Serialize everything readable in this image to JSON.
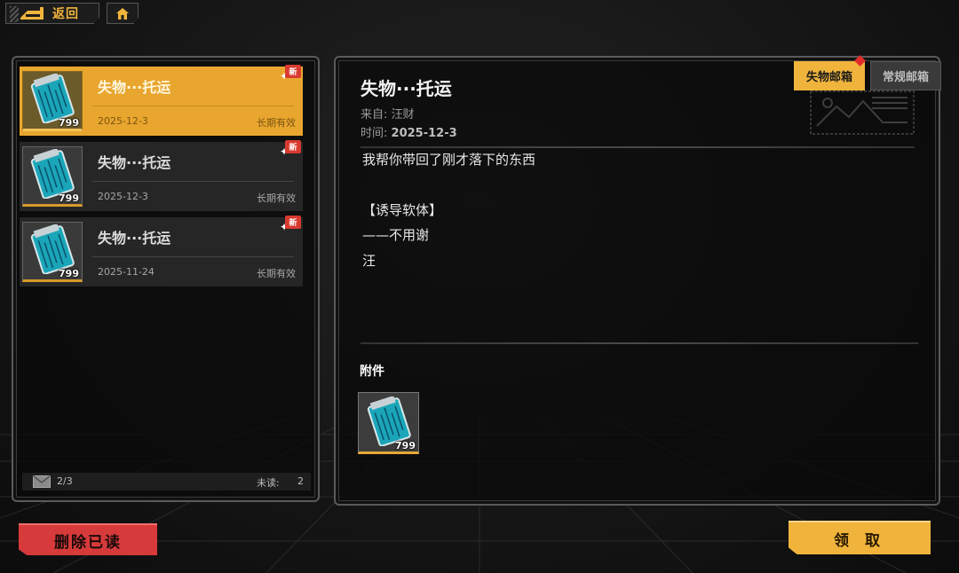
{
  "topbar": {
    "back_label": "返回"
  },
  "mail_list": {
    "items": [
      {
        "title": "失物···托运",
        "date": "2025-12-3",
        "validity": "长期有效",
        "badge": "新",
        "qty": "799",
        "selected": true
      },
      {
        "title": "失物···托运",
        "date": "2025-12-3",
        "validity": "长期有效",
        "badge": "新",
        "qty": "799",
        "selected": false
      },
      {
        "title": "失物···托运",
        "date": "2025-11-24",
        "validity": "长期有效",
        "badge": "新",
        "qty": "799",
        "selected": false
      }
    ],
    "count": "2/3",
    "unread_label": "未读:",
    "unread_count": "2"
  },
  "tabs": {
    "lost_mailbox": "失物邮箱",
    "regular_mailbox": "常规邮箱"
  },
  "detail": {
    "title": "失物···托运",
    "sender": "来自: 汪财",
    "time_label": "时间:",
    "time_value": "2025-12-3",
    "body_lines": [
      "我帮你带回了刚才落下的东西",
      "【诱导软体】",
      "——不用谢",
      "汪"
    ],
    "attachments_title": "附件",
    "attachment_qty": "799"
  },
  "actions": {
    "delete_read": "删除已读",
    "claim": "领 取"
  },
  "colors": {
    "accent": "#f0b43c",
    "danger": "#d63a3a",
    "badge": "#d93a2f"
  }
}
